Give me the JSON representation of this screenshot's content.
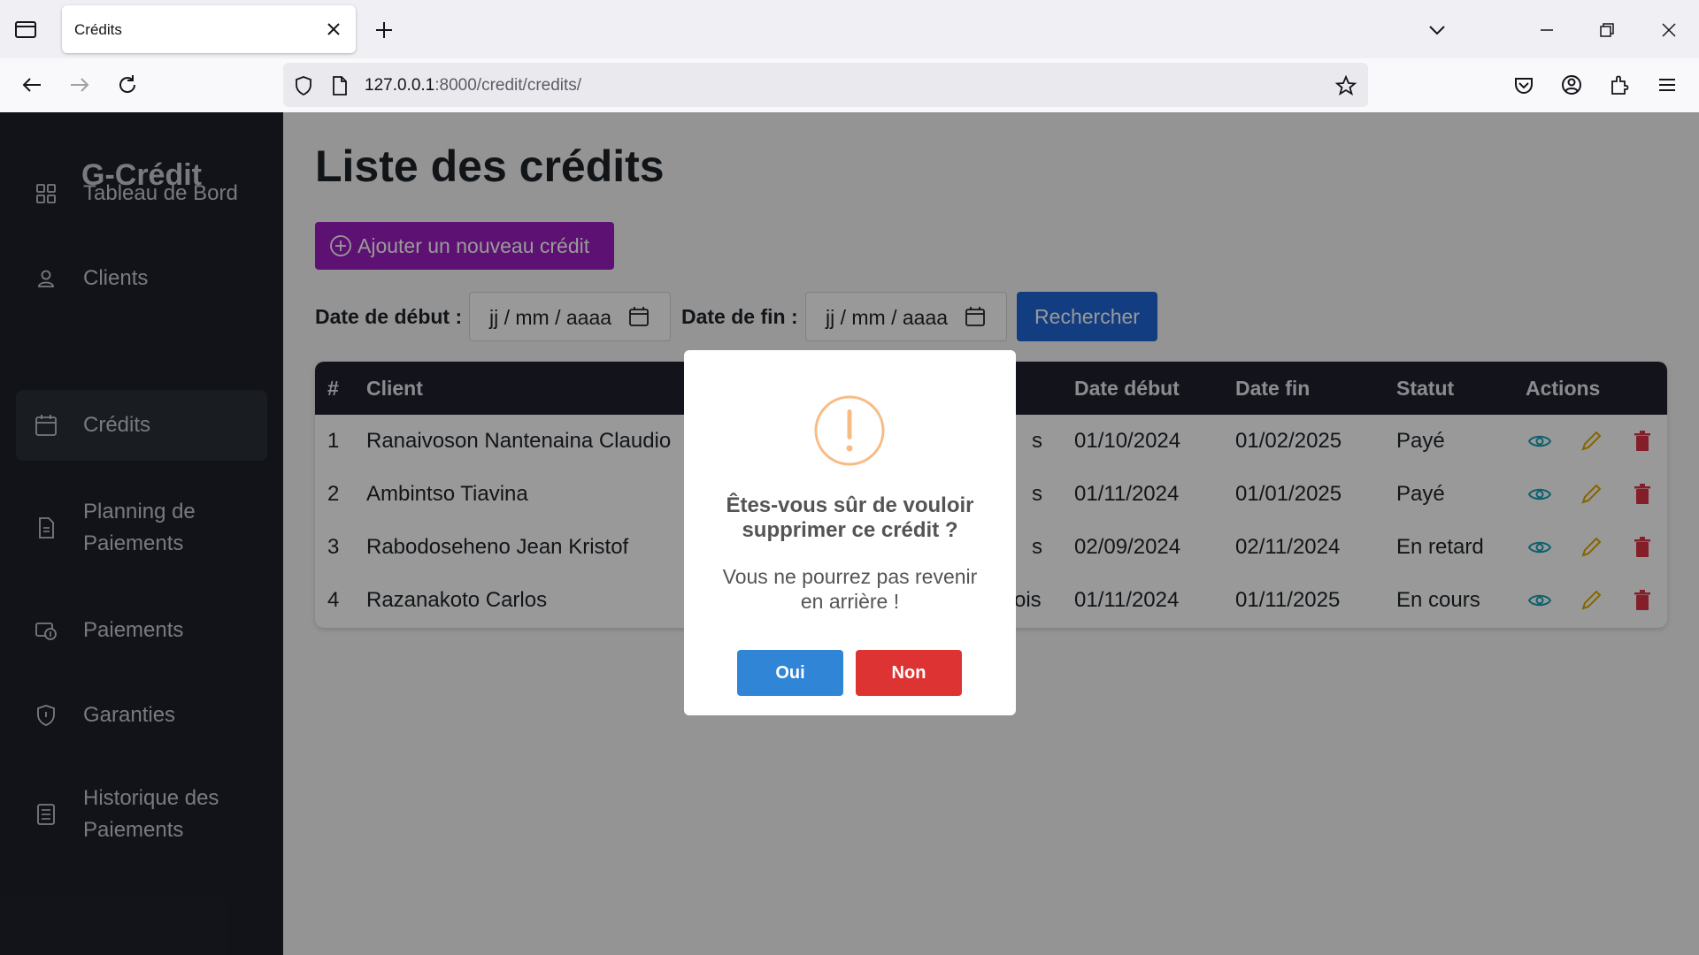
{
  "browser": {
    "tab_title": "Crédits",
    "url_host": "127.0.0.1",
    "url_rest": ":8000/credit/credits/"
  },
  "sidebar": {
    "brand": "G-Crédit",
    "items": [
      {
        "label_1": "Tableau de Bord",
        "label_2": "",
        "icon": "grid-icon"
      },
      {
        "label_1": "Clients",
        "label_2": "",
        "icon": "user-icon"
      },
      {
        "label_1": "Crédits",
        "label_2": "",
        "icon": "calendar-icon",
        "active": true
      },
      {
        "label_1": "Planning de",
        "label_2": "Paiements",
        "icon": "document-icon"
      },
      {
        "label_1": "Paiements",
        "label_2": "",
        "icon": "payment-icon"
      },
      {
        "label_1": "Garanties",
        "label_2": "",
        "icon": "shield-icon"
      },
      {
        "label_1": "Historique des",
        "label_2": "Paiements",
        "icon": "history-icon"
      }
    ]
  },
  "main": {
    "title": "Liste des crédits",
    "add_button": "Ajouter un nouveau crédit",
    "filter": {
      "start_label": "Date de début :",
      "end_label": "Date de fin :",
      "date_placeholder": "jj / mm / aaaa",
      "search_button": "Rechercher"
    },
    "table": {
      "headers": {
        "num": "#",
        "client": "Client",
        "start": "Date début",
        "end": "Date fin",
        "status": "Statut",
        "actions": "Actions"
      },
      "rows": [
        {
          "num": "1",
          "client": "Ranaivoson Nantenaina Claudio",
          "duration_tail": "s",
          "start": "01/10/2024",
          "end": "01/02/2025",
          "status": "Payé"
        },
        {
          "num": "2",
          "client": "Ambintso Tiavina",
          "duration_tail": "s",
          "start": "01/11/2024",
          "end": "01/01/2025",
          "status": "Payé"
        },
        {
          "num": "3",
          "client": "Rabodoseheno Jean Kristof",
          "duration_tail": "s",
          "start": "02/09/2024",
          "end": "02/11/2024",
          "status": "En retard"
        },
        {
          "num": "4",
          "client": "Razanakoto Carlos",
          "duration_tail": "ois",
          "start": "01/11/2024",
          "end": "01/11/2025",
          "status": "En cours"
        }
      ]
    }
  },
  "dialog": {
    "title": "Êtes-vous sûr de vouloir supprimer ce crédit ?",
    "text": "Vous ne pourrez pas revenir en arrière !",
    "confirm": "Oui",
    "cancel": "Non"
  },
  "colors": {
    "sidebar_bg": "#1e2129",
    "add_button": "#9b1fc0",
    "search_button": "#1f66d6",
    "confirm": "#3085d6",
    "cancel": "#dd3333",
    "warning": "#f8bb86"
  }
}
